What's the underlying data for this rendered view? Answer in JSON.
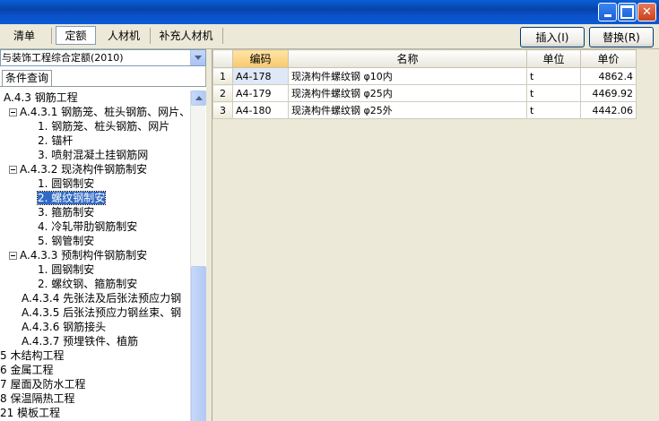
{
  "tabs": {
    "items": [
      "清单",
      "定额",
      "人材机",
      "补充人材机"
    ],
    "active": "定额"
  },
  "buttons": {
    "insert": "插入(I)",
    "replace": "替换(R)"
  },
  "left": {
    "combo_value": "与装饰工程综合定额(2010)",
    "query_tab": "条件查询",
    "tree": [
      "A.4.3 钢筋工程",
      "A.4.3.1 钢筋笼、桩头钢筋、网片、",
      "1. 钢筋笼、桩头钢筋、网片",
      "2. 锚杆",
      "3. 喷射混凝土挂钢筋网",
      "A.4.3.2 现浇构件钢筋制安",
      "1. 圆钢制安",
      "2. 螺纹钢制安",
      "3. 箍筋制安",
      "4. 冷轧带肋钢筋制安",
      "5. 钢管制安",
      "A.4.3.3 预制构件钢筋制安",
      "1. 圆钢制安",
      "2. 螺纹钢、箍筋制安",
      "A.4.3.4 先张法及后张法预应力钢",
      "A.4.3.5 后张法预应力钢丝束、钢",
      "A.4.3.6 钢筋接头",
      "A.4.3.7 预埋铁件、植筋",
      "5 木结构工程",
      "6 金属工程",
      "7 屋面及防水工程",
      "8 保温隔热工程",
      "21 模板工程"
    ],
    "selected": "2. 螺纹钢制安"
  },
  "grid": {
    "headers": [
      "编码",
      "名称",
      "单位",
      "单价"
    ],
    "rows": [
      {
        "n": "1",
        "code": "A4-178",
        "name": "现浇构件螺纹钢 φ10内",
        "unit": "t",
        "price": "4862.4"
      },
      {
        "n": "2",
        "code": "A4-179",
        "name": "现浇构件螺纹钢 φ25内",
        "unit": "t",
        "price": "4469.92"
      },
      {
        "n": "3",
        "code": "A4-180",
        "name": "现浇构件螺纹钢 φ25外",
        "unit": "t",
        "price": "4442.06"
      }
    ]
  }
}
